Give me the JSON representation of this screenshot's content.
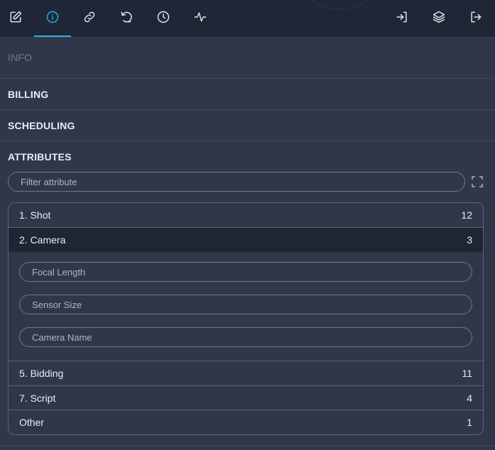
{
  "toolbar": {
    "left_icons": [
      "edit-icon",
      "info-icon",
      "link-icon",
      "history-icon",
      "clock-icon",
      "activity-icon"
    ],
    "right_icons": [
      "login-icon",
      "layers-icon",
      "logout-icon"
    ],
    "active": "info-icon",
    "accent": "#2ab0e8"
  },
  "sections": {
    "info": "INFO",
    "billing": "BILLING",
    "scheduling": "SCHEDULING",
    "attributes": "ATTRIBUTES"
  },
  "filter": {
    "placeholder": "Filter attribute"
  },
  "groups": [
    {
      "label": "1. Shot",
      "count": "12"
    },
    {
      "label": "2. Camera",
      "count": "3"
    },
    {
      "label": "5. Bidding",
      "count": "11"
    },
    {
      "label": "7. Script",
      "count": "4"
    },
    {
      "label": "Other",
      "count": "1"
    }
  ],
  "camera_fields": [
    {
      "placeholder": "Focal Length",
      "value": ""
    },
    {
      "placeholder": "Sensor Size",
      "value": ""
    },
    {
      "placeholder": "Camera Name",
      "value": ""
    }
  ]
}
